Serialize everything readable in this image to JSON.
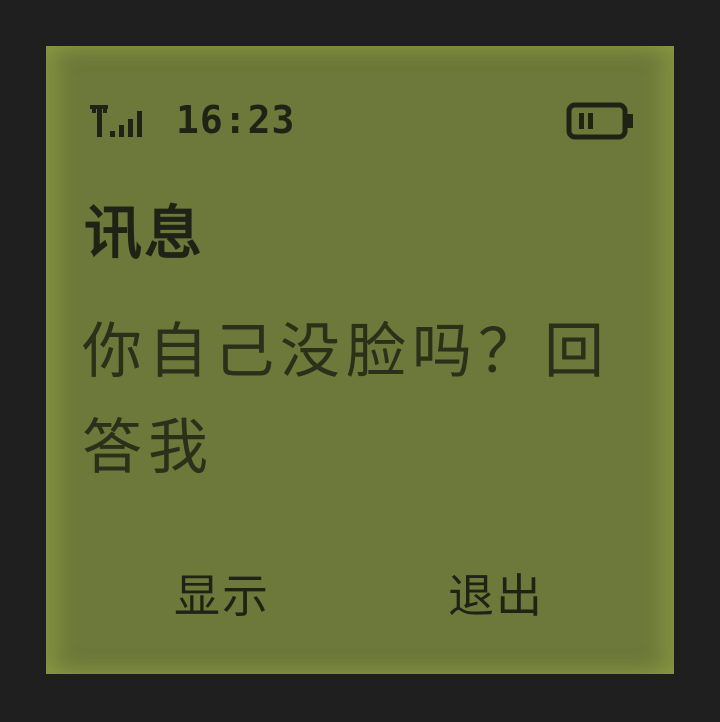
{
  "status": {
    "time": "16:23",
    "signal_icon": "signal-strength-icon",
    "battery_icon": "battery-icon",
    "signal_level": 4,
    "battery_level": 0.4
  },
  "message": {
    "title": "讯息",
    "body": "你自己没脸吗？回答我"
  },
  "softkeys": {
    "left": "显示",
    "right": "退出"
  },
  "colors": {
    "screen": "#6d793a",
    "bezel": "#1f1f20",
    "ink": "#1e2316"
  }
}
